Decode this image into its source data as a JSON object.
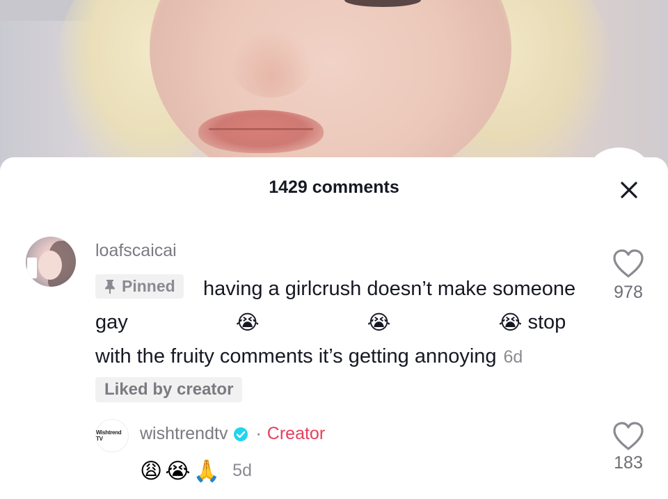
{
  "header": {
    "comments_count": "1429 comments"
  },
  "comments": [
    {
      "username": "loafscaicai",
      "pinned_label": "Pinned",
      "text_part1": "having a girlcrush doesn’t make someone gay",
      "emojis": [
        "😭",
        "😭",
        "😭"
      ],
      "text_part2": " stop with the fruity comments it’s getting annoying",
      "time": "6d",
      "liked_by_creator": "Liked by creator",
      "likes": "978"
    }
  ],
  "reply": {
    "avatar_text": "Wishtrend TV",
    "username": "wishtrendtv",
    "separator": "·",
    "creator_label": "Creator",
    "emojis": [
      "😩",
      "😭",
      "🙏"
    ],
    "time": "5d",
    "likes": "183"
  },
  "colors": {
    "creator": "#e83f5b",
    "verified": "#20d5ec",
    "text": "#161823",
    "muted": "#8a8b91"
  },
  "icons": [
    "close-icon",
    "pin-icon",
    "heart-icon",
    "verified-badge-icon"
  ]
}
